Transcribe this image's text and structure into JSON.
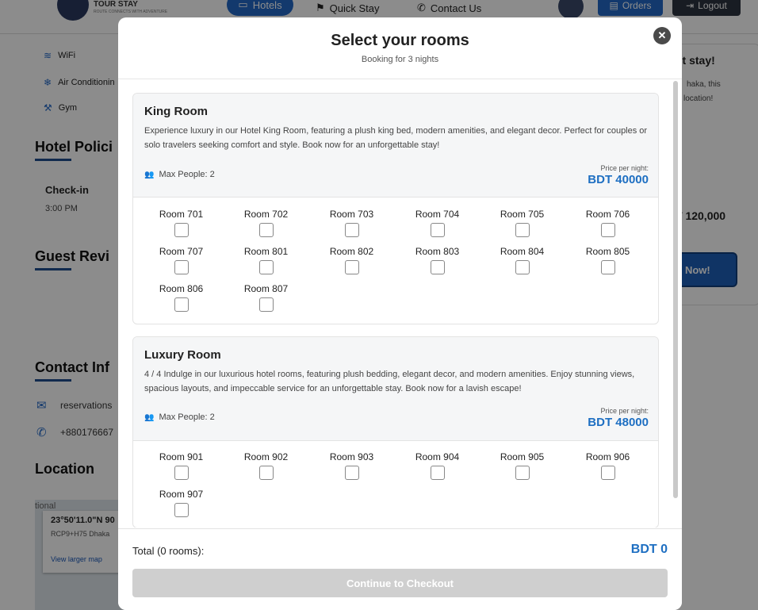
{
  "background": {
    "brand_name": "TOUR STAY",
    "brand_tagline": "ROUTE CONNECTS WITH ADVENTURE",
    "nav": {
      "hotels": "Hotels",
      "quick_stay": "Quick Stay",
      "contact": "Contact Us",
      "orders": "Orders",
      "logout": "Logout"
    },
    "amenities": [
      {
        "label": "WiFi",
        "icon": "wifi-icon"
      },
      {
        "label": "Air Conditionin",
        "icon": "snowflake-icon"
      },
      {
        "label": "Gym",
        "icon": "dumbbell-icon"
      }
    ],
    "policies_title": "Hotel Polici",
    "checkin_label": "Check-in",
    "checkin_time": "3:00 PM",
    "reviews_title": "Guest Revi",
    "contact_title": "Contact Inf",
    "contact_email": "reservations",
    "contact_phone": "+880176667",
    "location_title": "Location",
    "map": {
      "top_text": "tional",
      "coord": "23°50'11.0\"N 90",
      "plus": "RCP9+H75 Dhaka",
      "link": "View larger map"
    },
    "right_card": {
      "title": "nt stay!",
      "text1": "haka, this",
      "text2": "location!",
      "price": "T 120,000",
      "book": ": Now!"
    }
  },
  "modal": {
    "title": "Select your rooms",
    "subtitle": "Booking for 3 nights",
    "close_icon": "close-icon",
    "room_types": [
      {
        "name": "King Room",
        "description": "Experience luxury in our Hotel King Room, featuring a plush king bed, modern amenities, and elegant decor. Perfect for couples or solo travelers seeking comfort and style. Book now for an unforgettable stay!",
        "max_people": "Max People: 2",
        "price_label": "Price per night:",
        "price": "BDT 40000",
        "rooms": [
          "Room 701",
          "Room 702",
          "Room 703",
          "Room 704",
          "Room 705",
          "Room 706",
          "Room 707",
          "Room 801",
          "Room 802",
          "Room 803",
          "Room 804",
          "Room 805",
          "Room 806",
          "Room 807"
        ]
      },
      {
        "name": "Luxury Room",
        "description": "4 / 4 Indulge in our luxurious hotel rooms, featuring plush bedding, elegant decor, and modern amenities. Enjoy stunning views, spacious layouts, and impeccable service for an unforgettable stay. Book now for a lavish escape!",
        "max_people": "Max People: 2",
        "price_label": "Price per night:",
        "price": "BDT 48000",
        "rooms": [
          "Room 901",
          "Room 902",
          "Room 903",
          "Room 904",
          "Room 905",
          "Room 906",
          "Room 907"
        ]
      }
    ],
    "footer": {
      "total_label": "Total (0 rooms):",
      "total_value": "BDT 0",
      "checkout": "Continue to Checkout"
    },
    "colors": {
      "accent": "#1e6fc2",
      "disabled_button": "#cfcfcf",
      "brand_blue": "#2469c6"
    }
  }
}
